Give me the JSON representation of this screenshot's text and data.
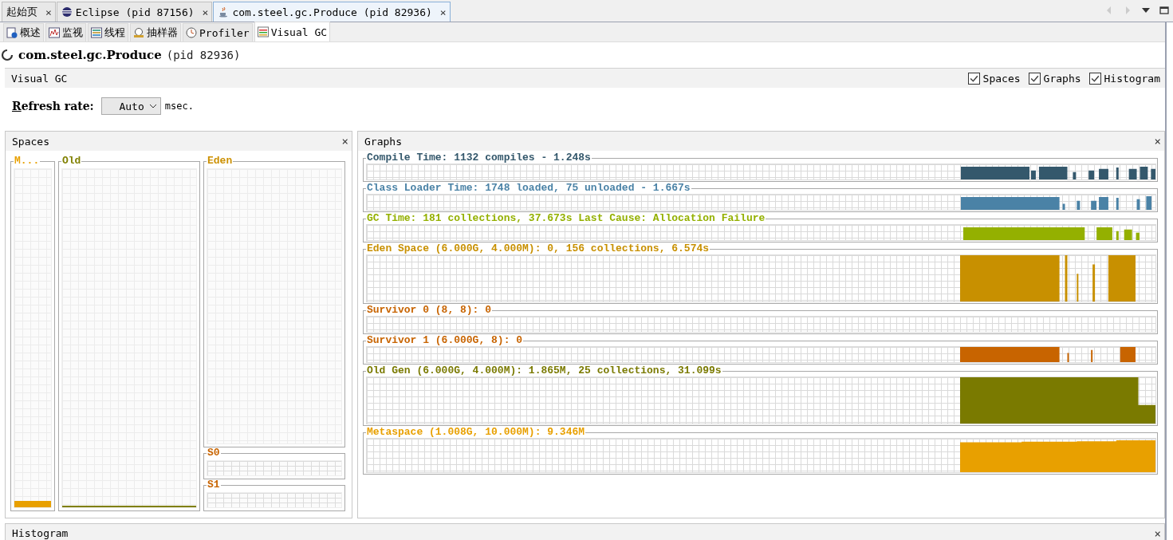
{
  "doc_tabs": [
    {
      "label": "起始页",
      "selected": false,
      "close": "×"
    },
    {
      "label": "Eclipse (pid 87156)",
      "selected": false,
      "close": "×"
    },
    {
      "label": "com.steel.gc.Produce (pid 82936)",
      "selected": true,
      "close": "×"
    }
  ],
  "view_tabs": [
    {
      "label": "概述",
      "selected": false
    },
    {
      "label": "监视",
      "selected": false
    },
    {
      "label": "线程",
      "selected": false
    },
    {
      "label": "抽样器",
      "selected": false
    },
    {
      "label": "Profiler",
      "selected": false
    },
    {
      "label": "Visual GC",
      "selected": true
    }
  ],
  "app_title": {
    "name": "com.steel.gc.Produce",
    "pid": "(pid 82936)"
  },
  "section": {
    "title": "Visual GC",
    "options": [
      {
        "label": "Spaces",
        "checked": true
      },
      {
        "label": "Graphs",
        "checked": true
      },
      {
        "label": "Histogram",
        "checked": true
      }
    ]
  },
  "refresh": {
    "label": "Refresh rate:",
    "value": "Auto",
    "unit": "msec."
  },
  "spaces_panel": {
    "title": "Spaces",
    "close": "×",
    "spaces": [
      {
        "label": "M...",
        "color": "#e8a000",
        "level": 0.02
      },
      {
        "label": "Old",
        "color": "#808000",
        "level": 0.005
      },
      {
        "label": "Eden",
        "color": "#cc9000",
        "level": 0
      },
      {
        "label": "S0",
        "color": "#c86400",
        "level": 0
      },
      {
        "label": "S1",
        "color": "#c86400",
        "level": 0
      }
    ]
  },
  "graphs_panel": {
    "title": "Graphs",
    "close": "×",
    "graphs": [
      {
        "title": "Compile Time: 1132 compiles - 1.248s",
        "color": "#34586c"
      },
      {
        "title": "Class Loader Time: 1748 loaded, 75 unloaded - 1.667s",
        "color": "#4a82a6"
      },
      {
        "title": "GC Time: 181 collections, 37.673s  Last Cause: Allocation Failure",
        "color": "#94b000"
      },
      {
        "title": "Eden Space (6.000G, 4.000M): 0, 156 collections, 6.574s",
        "color": "#c89000"
      },
      {
        "title": "Survivor 0 (8, 8): 0",
        "color": "#c86400"
      },
      {
        "title": "Survivor 1 (6.000G, 8): 0",
        "color": "#c86400"
      },
      {
        "title": "Old Gen (6.000G, 4.000M): 1.865M, 25 collections, 31.099s",
        "color": "#7a7a00"
      },
      {
        "title": "Metaspace (1.008G, 10.000M): 9.346M",
        "color": "#e8a000"
      }
    ]
  },
  "histogram_panel": {
    "title": "Histogram",
    "close": "×"
  }
}
